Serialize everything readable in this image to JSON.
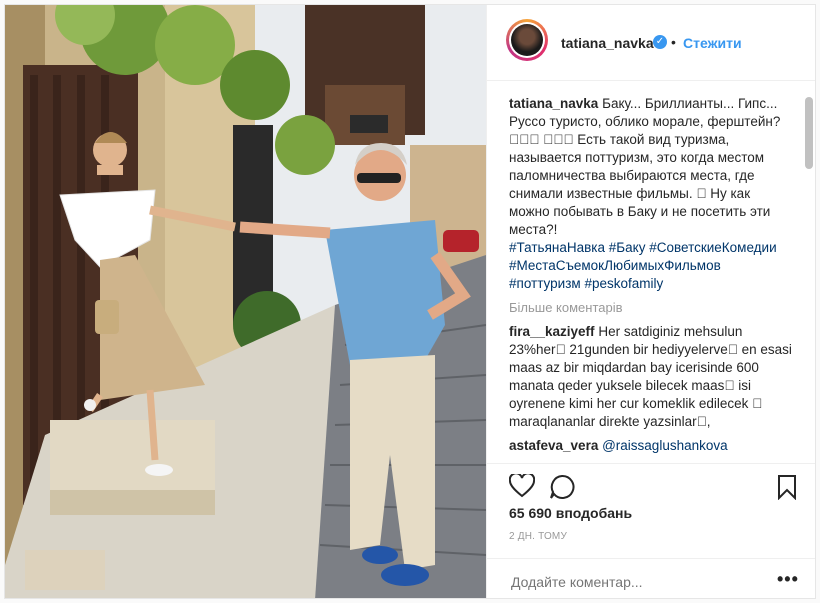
{
  "post": {
    "username": "tatiana_navka",
    "follow_label": "Стежити",
    "dot": "•",
    "verified_icon": "✓",
    "caption": {
      "user": "tatiana_navka",
      "text": "Баку... Бриллианты... Гипс... Руссо туристо, облико морале, ферштейн? 󾓬󾓬󾓬 󾓬󾓬󾓬 Есть такой вид туризма, называется поттуризм, это когда местом паломничества выбираются места, где снимали известные фильмы. 󾓬 Ну как можно побывать в Баку и не посетить эти места?!",
      "hashtags": [
        "#ТатьянаНавка",
        "#Баку",
        "#СоветскиеКомедии",
        "#МестаСъемокЛюбимыхФильмов",
        "#поттуризм",
        "#peskofamily"
      ]
    },
    "more_comments": "Більше коментарів",
    "comments": [
      {
        "user": "fira__kaziyeff",
        "text": "Her satdiginiz mehsulun 23%her󾓬 21gunden bir hediyyelerve󾓬 en esasi maas az bir miqdardan bay icerisinde 600 manata qeder yuksele bilecek maas󾓬 isi oyrenene kimi her cur komeklik edilecek 󾓬 maraqlananlar direkte yazsinlar󾓬,"
      },
      {
        "user": "astafeva_vera",
        "text": "@raissaglushankova"
      }
    ],
    "likes": "65 690 вподобань",
    "time": "2 ДН. ТОМУ",
    "add_comment_placeholder": "Додайте коментар...",
    "more_options": "•••",
    "icons": {
      "like": "heart-icon",
      "comment": "comment-icon",
      "save": "bookmark-icon"
    }
  },
  "colors": {
    "link_blue": "#3897f0",
    "hashtag": "#003569",
    "muted": "#999999"
  }
}
